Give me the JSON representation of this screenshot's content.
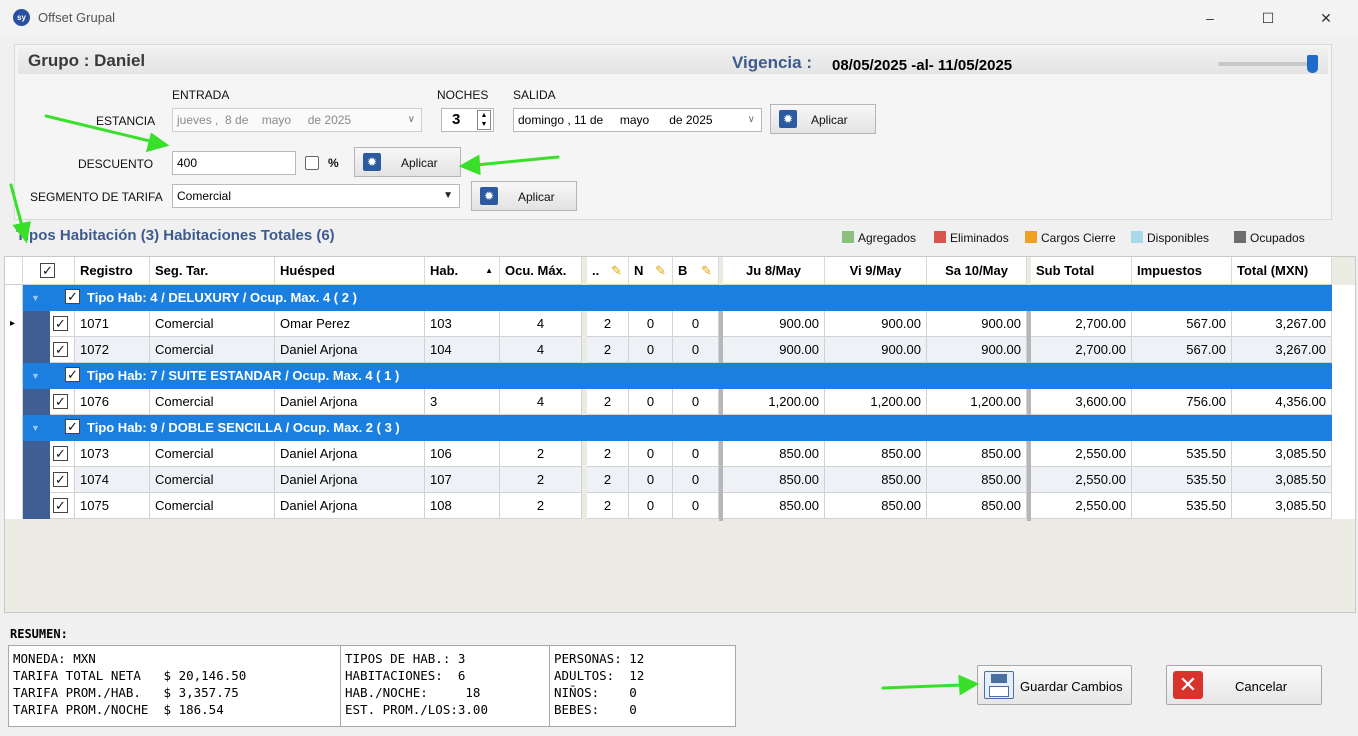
{
  "window": {
    "title": "Offset Grupal",
    "app_badge": "sy"
  },
  "header": {
    "group_title": "Grupo : Daniel",
    "validity_label": "Vigencia :",
    "validity_value": "08/05/2025 -al- 11/05/2025"
  },
  "stay": {
    "entrada_label": "ENTRADA",
    "noches_label": "NOCHES",
    "salida_label": "SALIDA",
    "estancia_label": "ESTANCIA",
    "entrada_value": "jueves ,  8 de    mayo     de 2025",
    "noches_value": "3",
    "salida_value": "domingo , 11 de     mayo      de 2025",
    "apply_label": "Aplicar"
  },
  "discount": {
    "label": "DESCUENTO",
    "value": "400",
    "percent_label": "%",
    "apply_label": "Aplicar"
  },
  "segment": {
    "label": "SEGMENTO DE TARIFA",
    "value": "Comercial",
    "apply_label": "Aplicar"
  },
  "grid_title": "Tipos Habitación (3) Habitaciones Totales (6)",
  "legend": [
    {
      "label": "Agregados",
      "color": "#8dbf80"
    },
    {
      "label": "Eliminados",
      "color": "#d9534f"
    },
    {
      "label": "Cargos Cierre",
      "color": "#f0a020"
    },
    {
      "label": "Disponibles",
      "color": "#a8d8ea"
    },
    {
      "label": "Ocupados",
      "color": "#6e6e6e"
    }
  ],
  "columns": [
    "Registro",
    "Seg. Tar.",
    "Huésped",
    "Hab.",
    "Ocu. Máx.",
    "..",
    "N",
    "B",
    "Ju 8/May",
    "Vi 9/May",
    "Sa 10/May",
    "Sub Total",
    "Impuestos",
    "Total (MXN)"
  ],
  "groups": [
    {
      "label": "Tipo Hab: 4 / DELUXURY / Ocup. Max.  4 ( 2 )",
      "rows": [
        [
          "1071",
          "Comercial",
          "Omar Perez",
          "103",
          "4",
          "2",
          "0",
          "0",
          "900.00",
          "900.00",
          "900.00",
          "2,700.00",
          "567.00",
          "3,267.00"
        ],
        [
          "1072",
          "Comercial",
          "Daniel Arjona",
          "104",
          "4",
          "2",
          "0",
          "0",
          "900.00",
          "900.00",
          "900.00",
          "2,700.00",
          "567.00",
          "3,267.00"
        ]
      ]
    },
    {
      "label": "Tipo Hab: 7 / SUITE ESTANDAR / Ocup. Max.  4 ( 1 )",
      "rows": [
        [
          "1076",
          "Comercial",
          "Daniel Arjona",
          "3",
          "4",
          "2",
          "0",
          "0",
          "1,200.00",
          "1,200.00",
          "1,200.00",
          "3,600.00",
          "756.00",
          "4,356.00"
        ]
      ]
    },
    {
      "label": "Tipo Hab: 9 / DOBLE SENCILLA / Ocup. Max.  2 ( 3 )",
      "rows": [
        [
          "1073",
          "Comercial",
          "Daniel Arjona",
          "106",
          "2",
          "2",
          "0",
          "0",
          "850.00",
          "850.00",
          "850.00",
          "2,550.00",
          "535.50",
          "3,085.50"
        ],
        [
          "1074",
          "Comercial",
          "Daniel Arjona",
          "107",
          "2",
          "2",
          "0",
          "0",
          "850.00",
          "850.00",
          "850.00",
          "2,550.00",
          "535.50",
          "3,085.50"
        ],
        [
          "1075",
          "Comercial",
          "Daniel Arjona",
          "108",
          "2",
          "2",
          "0",
          "0",
          "850.00",
          "850.00",
          "850.00",
          "2,550.00",
          "535.50",
          "3,085.50"
        ]
      ]
    }
  ],
  "summary": {
    "title": "RESUMEN:",
    "col1": "MONEDA: MXN\nTARIFA TOTAL NETA   $ 20,146.50\nTARIFA PROM./HAB.   $ 3,357.75\nTARIFA PROM./NOCHE  $ 186.54",
    "col2": "TIPOS DE HAB.: 3\nHABITACIONES:  6\nHAB./NOCHE:     18\nEST. PROM./LOS:3.00",
    "col3": "PERSONAS: 12\nADULTOS:  12\nNIÑOS:    0\nBEBES:    0"
  },
  "actions": {
    "save_label": "Guardar Cambios",
    "cancel_label": "Cancelar"
  }
}
